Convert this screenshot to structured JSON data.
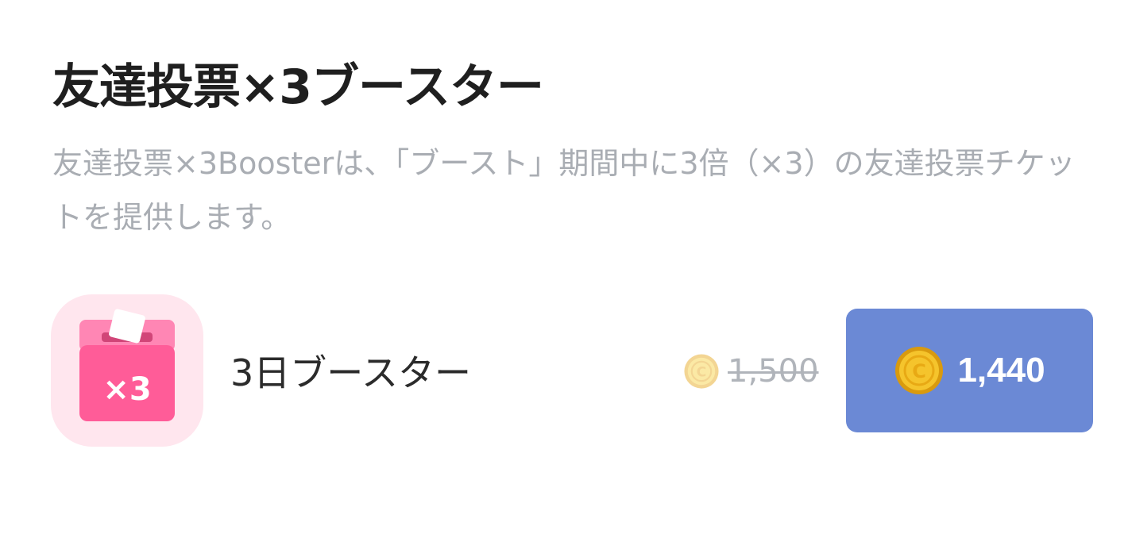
{
  "header": {
    "title": "友達投票×3ブースター",
    "description": "友達投票×3Boosterは、「ブースト」期間中に3倍（×3）の友達投票チケットを提供します。"
  },
  "product": {
    "icon_name": "ballot-box-x3-icon",
    "icon_badge": "×3",
    "name": "3日ブースター",
    "original_price": "1,500",
    "price": "1,440",
    "currency_icon": "coin-icon"
  },
  "colors": {
    "button_bg": "#6b89d5",
    "icon_bg": "#ffe6ee",
    "icon_box": "#ff5c98",
    "coin_gold": "#f2c230"
  }
}
